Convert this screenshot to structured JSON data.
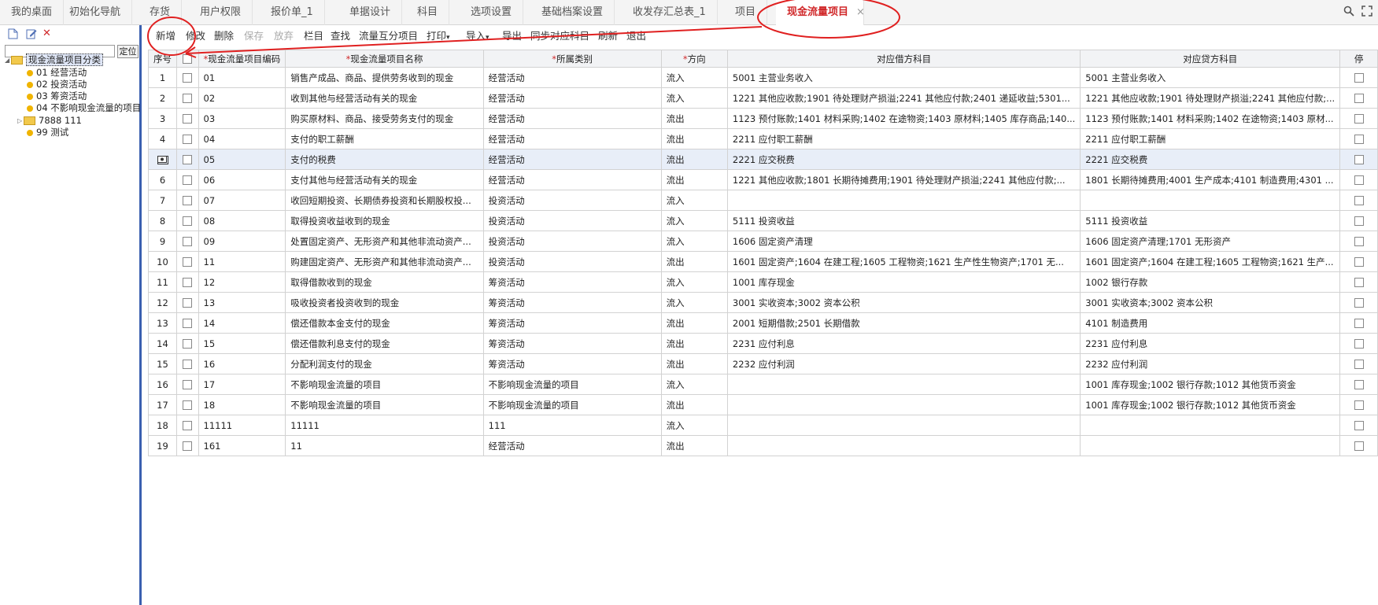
{
  "tabs": [
    {
      "label": "我的桌面"
    },
    {
      "label": "初始化导航"
    },
    {
      "label": "存货"
    },
    {
      "label": "用户权限"
    },
    {
      "label": "报价单_1"
    },
    {
      "label": "单据设计"
    },
    {
      "label": "科目"
    },
    {
      "label": "选项设置"
    },
    {
      "label": "基础档案设置"
    },
    {
      "label": "收发存汇总表_1"
    },
    {
      "label": "项目"
    },
    {
      "label": "现金流量项目",
      "active": true,
      "close": "×"
    }
  ],
  "left_panel": {
    "search_placeholder": "",
    "locate_label": "定位",
    "tree": {
      "root": "现金流量项目分类",
      "children": [
        {
          "label": "01 经营活动"
        },
        {
          "label": "02 投资活动"
        },
        {
          "label": "03 筹资活动"
        },
        {
          "label": "04 不影响现金流量的项目"
        },
        {
          "label": "7888 111"
        },
        {
          "label": "99 测试"
        }
      ]
    }
  },
  "toolbar": {
    "items": [
      "新增",
      "修改",
      "删除",
      "保存",
      "放弃",
      "栏目",
      "查找",
      "流量互分项目",
      "打印",
      "导入",
      "导出",
      "同步对应科目",
      "刷新",
      "退出"
    ]
  },
  "grid": {
    "headers": {
      "seq": "序号",
      "code": "现金流量项目编码",
      "name": "现金流量项目名称",
      "category": "所属类别",
      "direction": "方向",
      "debit": "对应借方科目",
      "credit": "对应贷方科目",
      "stop": "停"
    },
    "rows": [
      {
        "seq": "1",
        "code": "01",
        "name": "销售产成品、商品、提供劳务收到的现金",
        "category": "经营活动",
        "direction": "流入",
        "debit": "5001 主营业务收入",
        "credit": "5001 主营业务收入"
      },
      {
        "seq": "2",
        "code": "02",
        "name": "收到其他与经营活动有关的现金",
        "category": "经营活动",
        "direction": "流入",
        "debit": "1221 其他应收款;1901 待处理财产损溢;2241 其他应付款;2401 递延收益;5301...",
        "credit": "1221 其他应收款;1901 待处理财产损溢;2241 其他应付款;..."
      },
      {
        "seq": "3",
        "code": "03",
        "name": "购买原材料、商品、接受劳务支付的现金",
        "category": "经营活动",
        "direction": "流出",
        "debit": "1123 预付账款;1401 材料采购;1402 在途物资;1403 原材料;1405 库存商品;140...",
        "credit": "1123 预付账款;1401 材料采购;1402 在途物资;1403 原材..."
      },
      {
        "seq": "4",
        "code": "04",
        "name": "支付的职工薪酬",
        "category": "经营活动",
        "direction": "流出",
        "debit": "2211 应付职工薪酬",
        "credit": "2211 应付职工薪酬"
      },
      {
        "seq": "5",
        "code": "05",
        "name": "支付的税费",
        "category": "经营活动",
        "direction": "流出",
        "debit": "2221 应交税费",
        "credit": "2221 应交税费",
        "selected": true
      },
      {
        "seq": "6",
        "code": "06",
        "name": "支付其他与经营活动有关的现金",
        "category": "经营活动",
        "direction": "流出",
        "debit": "1221 其他应收款;1801 长期待摊费用;1901 待处理财产损溢;2241 其他应付款;...",
        "credit": "1801 长期待摊费用;4001 生产成本;4101 制造费用;4301 ..."
      },
      {
        "seq": "7",
        "code": "07",
        "name": "收回短期投资、长期债券投资和长期股权投...",
        "category": "投资活动",
        "direction": "流入",
        "debit": "",
        "credit": ""
      },
      {
        "seq": "8",
        "code": "08",
        "name": "取得投资收益收到的现金",
        "category": "投资活动",
        "direction": "流入",
        "debit": "5111 投资收益",
        "credit": "5111 投资收益"
      },
      {
        "seq": "9",
        "code": "09",
        "name": "处置固定资产、无形资产和其他非流动资产...",
        "category": "投资活动",
        "direction": "流入",
        "debit": "1606 固定资产清理",
        "credit": "1606 固定资产清理;1701 无形资产"
      },
      {
        "seq": "10",
        "code": "11",
        "name": "购建固定资产、无形资产和其他非流动资产...",
        "category": "投资活动",
        "direction": "流出",
        "debit": "1601 固定资产;1604 在建工程;1605 工程物资;1621 生产性生物资产;1701 无...",
        "credit": "1601 固定资产;1604 在建工程;1605 工程物资;1621 生产..."
      },
      {
        "seq": "11",
        "code": "12",
        "name": "取得借款收到的现金",
        "category": "筹资活动",
        "direction": "流入",
        "debit": "1001 库存现金",
        "credit": "1002 银行存款"
      },
      {
        "seq": "12",
        "code": "13",
        "name": "吸收投资者投资收到的现金",
        "category": "筹资活动",
        "direction": "流入",
        "debit": "3001 实收资本;3002 资本公积",
        "credit": "3001 实收资本;3002 资本公积"
      },
      {
        "seq": "13",
        "code": "14",
        "name": "偿还借款本金支付的现金",
        "category": "筹资活动",
        "direction": "流出",
        "debit": "2001 短期借款;2501 长期借款",
        "credit": "4101 制造费用"
      },
      {
        "seq": "14",
        "code": "15",
        "name": "偿还借款利息支付的现金",
        "category": "筹资活动",
        "direction": "流出",
        "debit": "2231 应付利息",
        "credit": "2231 应付利息"
      },
      {
        "seq": "15",
        "code": "16",
        "name": "分配利润支付的现金",
        "category": "筹资活动",
        "direction": "流出",
        "debit": "2232 应付利润",
        "credit": "2232 应付利润"
      },
      {
        "seq": "16",
        "code": "17",
        "name": "不影响现金流量的项目",
        "category": "不影响现金流量的项目",
        "direction": "流入",
        "debit": "",
        "credit": "1001 库存现金;1002 银行存款;1012 其他货币资金"
      },
      {
        "seq": "17",
        "code": "18",
        "name": "不影响现金流量的项目",
        "category": "不影响现金流量的项目",
        "direction": "流出",
        "debit": "",
        "credit": "1001 库存现金;1002 银行存款;1012 其他货币资金"
      },
      {
        "seq": "18",
        "code": "11111",
        "name": "11111",
        "category": "111",
        "direction": "流入",
        "debit": "",
        "credit": ""
      },
      {
        "seq": "19",
        "code": "161",
        "name": "11",
        "category": "经营活动",
        "direction": "流出",
        "debit": "",
        "credit": ""
      }
    ]
  }
}
